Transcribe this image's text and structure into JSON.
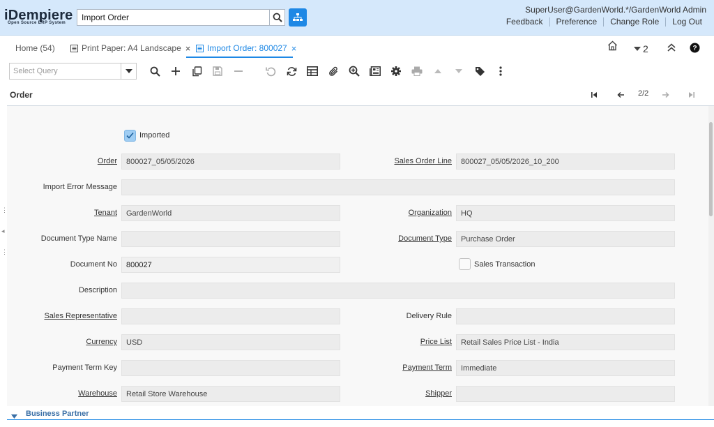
{
  "header": {
    "logo_text": "iDempiere",
    "logo_subtitle": "Open Source ERP System",
    "search_value": "Import Order",
    "user": "SuperUser@GardenWorld.*/GardenWorld Admin",
    "links": [
      "Feedback",
      "Preference",
      "Change Role",
      "Log Out"
    ]
  },
  "tabs": [
    {
      "label": "Home (54)",
      "active": false,
      "closable": false
    },
    {
      "label": "Print Paper: A4 Landscape",
      "active": false,
      "closable": true
    },
    {
      "label": "Import Order: 800027",
      "active": true,
      "closable": true
    }
  ],
  "tab_close_glyph": "×",
  "right_controls": {
    "window_count": "2"
  },
  "toolbar": {
    "query_placeholder": "Select Query",
    "icons": [
      "search-icon",
      "new-record-icon",
      "copy-icon",
      "save-icon",
      "delete-icon",
      "undo-icon",
      "refresh-icon",
      "grid-toggle-icon",
      "attachment-icon",
      "zoom-across-icon",
      "report-icon",
      "process-icon",
      "print-icon",
      "parent-record-icon",
      "detail-record-icon",
      "tag-icon",
      "more-icon"
    ]
  },
  "detail": {
    "title": "Order",
    "record_count": "2/2"
  },
  "form": {
    "imported_label": "Imported",
    "imported_checked": true,
    "order_label": "Order",
    "order_value": "800027_05/05/2026",
    "sales_order_line_label": "Sales Order Line",
    "sales_order_line_value": "800027_05/05/2026_10_200",
    "import_error_label": "Import Error Message",
    "import_error_value": "",
    "tenant_label": "Tenant",
    "tenant_value": "GardenWorld",
    "organization_label": "Organization",
    "organization_value": "HQ",
    "doc_type_name_label": "Document Type Name",
    "doc_type_name_value": "",
    "doc_type_label": "Document Type",
    "doc_type_value": "Purchase Order",
    "document_no_label": "Document No",
    "document_no_value": "800027",
    "sales_transaction_label": "Sales Transaction",
    "sales_transaction_checked": false,
    "description_label": "Description",
    "description_value": "",
    "sales_rep_label": "Sales Representative",
    "sales_rep_value": "",
    "delivery_rule_label": "Delivery Rule",
    "delivery_rule_value": "",
    "currency_label": "Currency",
    "currency_value": "USD",
    "price_list_label": "Price List",
    "price_list_value": "Retail Sales Price List - India",
    "payment_term_key_label": "Payment Term Key",
    "payment_term_key_value": "",
    "payment_term_label": "Payment Term",
    "payment_term_value": "Immediate",
    "warehouse_label": "Warehouse",
    "warehouse_value": "Retail Store Warehouse",
    "shipper_label": "Shipper",
    "shipper_value": ""
  },
  "section": {
    "title": "Business Partner"
  },
  "colors": {
    "header_bg": "#d5e8fb",
    "accent": "#1e88e5",
    "section_title": "#3a6fa6"
  }
}
